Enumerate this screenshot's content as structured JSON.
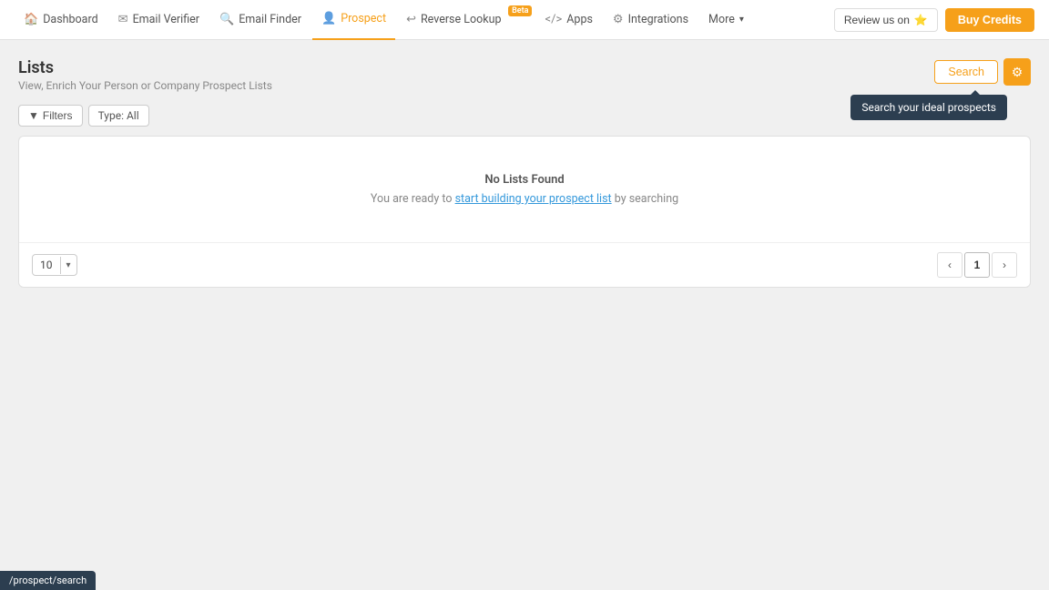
{
  "nav": {
    "items": [
      {
        "id": "dashboard",
        "label": "Dashboard",
        "icon": "🏠",
        "active": false
      },
      {
        "id": "email-verifier",
        "label": "Email Verifier",
        "icon": "✉",
        "active": false
      },
      {
        "id": "email-finder",
        "label": "Email Finder",
        "icon": "🔍",
        "active": false
      },
      {
        "id": "prospect",
        "label": "Prospect",
        "icon": "👤",
        "active": true,
        "beta": false
      },
      {
        "id": "reverse-lookup",
        "label": "Reverse Lookup",
        "icon": "↩",
        "active": false,
        "beta": true
      },
      {
        "id": "apps",
        "label": "Apps",
        "icon": "<>",
        "active": false
      },
      {
        "id": "integrations",
        "label": "Integrations",
        "icon": "⚙",
        "active": false
      },
      {
        "id": "more",
        "label": "More",
        "icon": "",
        "active": false,
        "dropdown": true
      }
    ],
    "review_btn_label": "Review us on",
    "review_icon": "⭐",
    "buy_credits_label": "Buy Credits"
  },
  "page": {
    "title": "Lists",
    "subtitle": "View, Enrich Your Person or Company Prospect Lists",
    "search_btn_label": "Search",
    "settings_tooltip": "Search your ideal prospects"
  },
  "filters": {
    "filter_btn_label": "Filters",
    "type_badge_label": "Type: All"
  },
  "empty_state": {
    "title": "No Lists Found",
    "desc_before": "You are ready to ",
    "link_text": "start building your prospect list",
    "desc_after": " by searching"
  },
  "pagination": {
    "page_size": "10",
    "current_page": "1"
  },
  "url_bar": {
    "url": "/prospect/search"
  }
}
